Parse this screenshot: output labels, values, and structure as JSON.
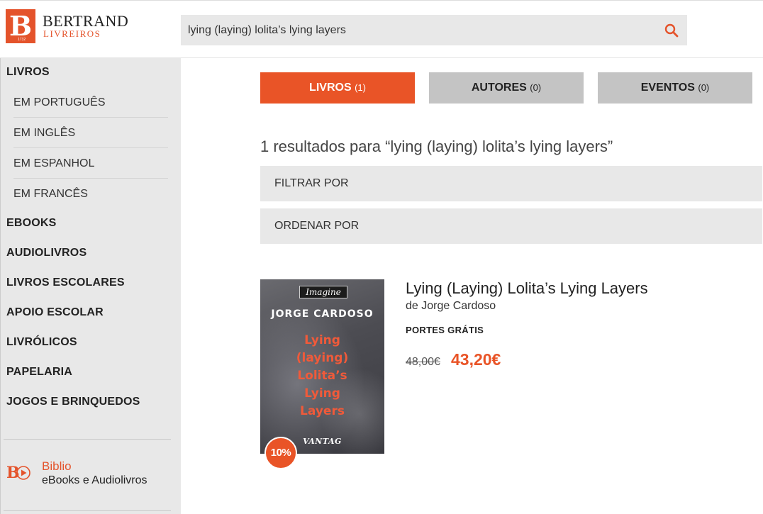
{
  "header": {
    "logo_brand": "BERTRAND",
    "logo_sub": "LIVREIROS",
    "logo_year": "1732",
    "search_value": "lying (laying) lolita’s lying layers",
    "search_icon": "search-icon",
    "accent": "#e4532b"
  },
  "sidebar": {
    "livros": "LIVROS",
    "sub_items": [
      "EM PORTUGUÊS",
      "EM INGLÊS",
      "EM ESPANHOL",
      "EM FRANCÊS"
    ],
    "items": [
      "EBOOKS",
      "AUDIOLIVROS",
      "LIVROS ESCOLARES",
      "APOIO ESCOLAR",
      "LIVRÓLICOS",
      "PAPELARIA",
      "JOGOS E BRINQUEDOS"
    ],
    "biblio_title": "Biblio",
    "biblio_sub": "eBooks e Audiolivros"
  },
  "tabs": [
    {
      "label": "LIVROS",
      "count": "(1)",
      "active": true
    },
    {
      "label": "AUTORES",
      "count": "(0)",
      "active": false
    },
    {
      "label": "EVENTOS",
      "count": "(0)",
      "active": false
    }
  ],
  "results": {
    "title": "1 resultados para “lying (laying) lolita’s lying layers”",
    "filter_label": "FILTRAR POR",
    "sort_label": "ORDENAR POR"
  },
  "book": {
    "title": "Lying (Laying) Lolita’s Lying Layers",
    "author": "de Jorge Cardoso",
    "shipping": "PORTES GRÁTIS",
    "price_old": "48,00€",
    "price_new": "43,20€",
    "discount": "10%",
    "cover": {
      "series": "Imagine",
      "author": "JORGE CARDOSO",
      "title": "Lying\n(laying)\nLolita’s\nLying\nLayers",
      "publisher": "VANTAG"
    }
  }
}
